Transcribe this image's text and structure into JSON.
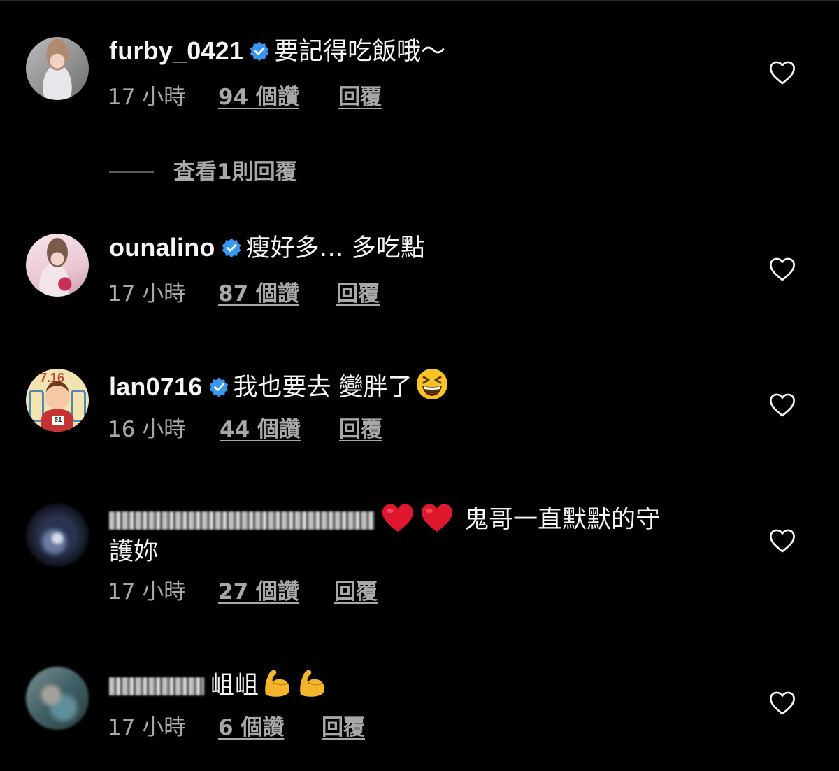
{
  "comments": [
    {
      "username": "furby_0421",
      "verified": true,
      "text": "要記得吃飯哦～",
      "time": "17 小時",
      "likes": "94 個讚",
      "reply": "回覆",
      "avatar": "avatar-furby",
      "replies_link": "查看1則回覆"
    },
    {
      "username": "ounalino",
      "verified": true,
      "text": "瘦好多… 多吃點",
      "time": "17 小時",
      "likes": "87 個讚",
      "reply": "回覆",
      "avatar": "avatar-ounalino"
    },
    {
      "username": "lan0716",
      "verified": true,
      "text": "我也要去 變胖了",
      "emoji": "grinning-squinting-face",
      "time": "16 小時",
      "likes": "44 個讚",
      "reply": "回覆",
      "avatar": "avatar-lan0716",
      "avatar_text": "7.16"
    },
    {
      "username_blurred": true,
      "emoji": "red-heart x2",
      "text_line1": "鬼哥一直默默的守",
      "text_line2": "護妳",
      "time": "17 小時",
      "likes": "27 個讚",
      "reply": "回覆",
      "avatar": "avatar-blurred"
    },
    {
      "username_blurred": true,
      "text": "岨岨",
      "emoji": "flexed-biceps x2",
      "time": "17 小時",
      "likes": "6 個讚",
      "reply": "回覆",
      "avatar": "avatar-blurred"
    }
  ],
  "colors": {
    "background": "#000000",
    "text": "#f5f5f5",
    "meta": "#a8a8a8",
    "verified": "#3897f0"
  },
  "icons": {
    "verified": "verified-badge-icon",
    "like": "heart-outline-icon"
  }
}
